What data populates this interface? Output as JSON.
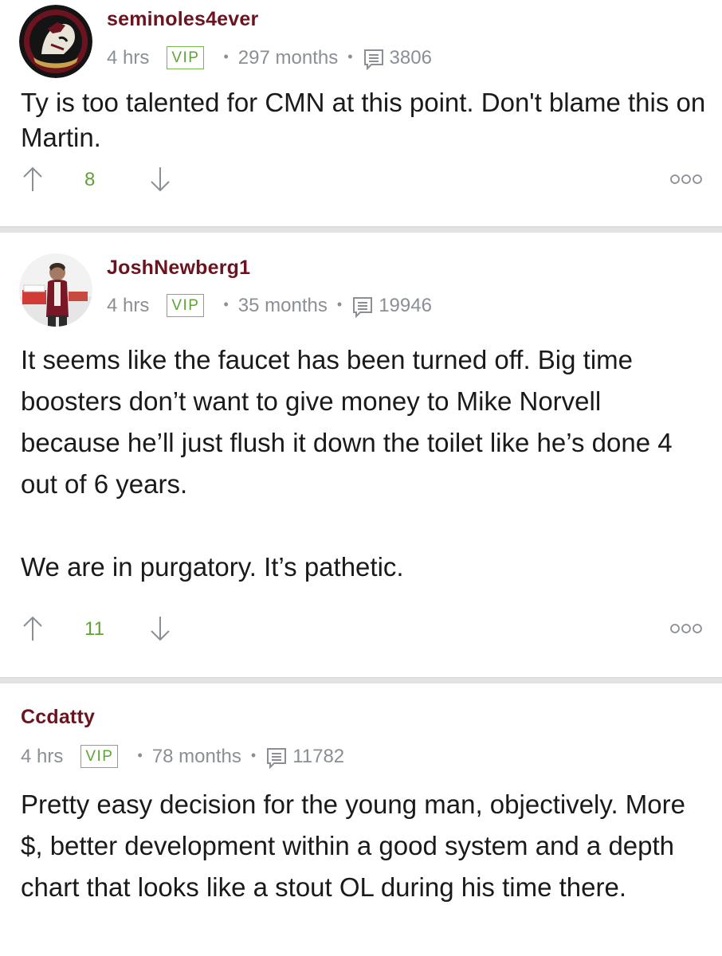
{
  "posts": [
    {
      "username": "seminoles4ever",
      "time": "4 hrs",
      "badge": "VIP",
      "tenure": "297 months",
      "post_count": "3806",
      "body": [
        "Ty is too talented for CMN at this point. Don't blame this on Martin."
      ],
      "votes": "8",
      "avatar_icon": "seminole-logo-avatar"
    },
    {
      "username": "JoshNewberg1",
      "time": "4 hrs",
      "badge": "VIP",
      "tenure": "35 months",
      "post_count": "19946",
      "body": [
        "It seems like the faucet has been turned off. Big time boosters don’t want to give money to Mike Norvell because he’ll just flush it down the toilet like he’s done 4 out of 6 years.",
        "We are in purgatory. It’s pathetic."
      ],
      "votes": "11",
      "avatar_icon": "user-photo-avatar"
    },
    {
      "username": "Ccdatty",
      "time": "4 hrs",
      "badge": "VIP",
      "tenure": "78 months",
      "post_count": "11782",
      "body": [
        "Pretty easy decision for the young man, objectively. More $, better development within a good system and a depth chart that looks like a stout OL during his time there."
      ]
    }
  ],
  "icons": {
    "upvote": "arrow-up-icon",
    "downvote": "arrow-down-icon",
    "more": "more-options-icon",
    "posts": "message-count-icon"
  },
  "colors": {
    "username": "#6b1420",
    "vip": "#5fa336",
    "meta": "#8a8f96",
    "divider": "#e3e3e3"
  }
}
